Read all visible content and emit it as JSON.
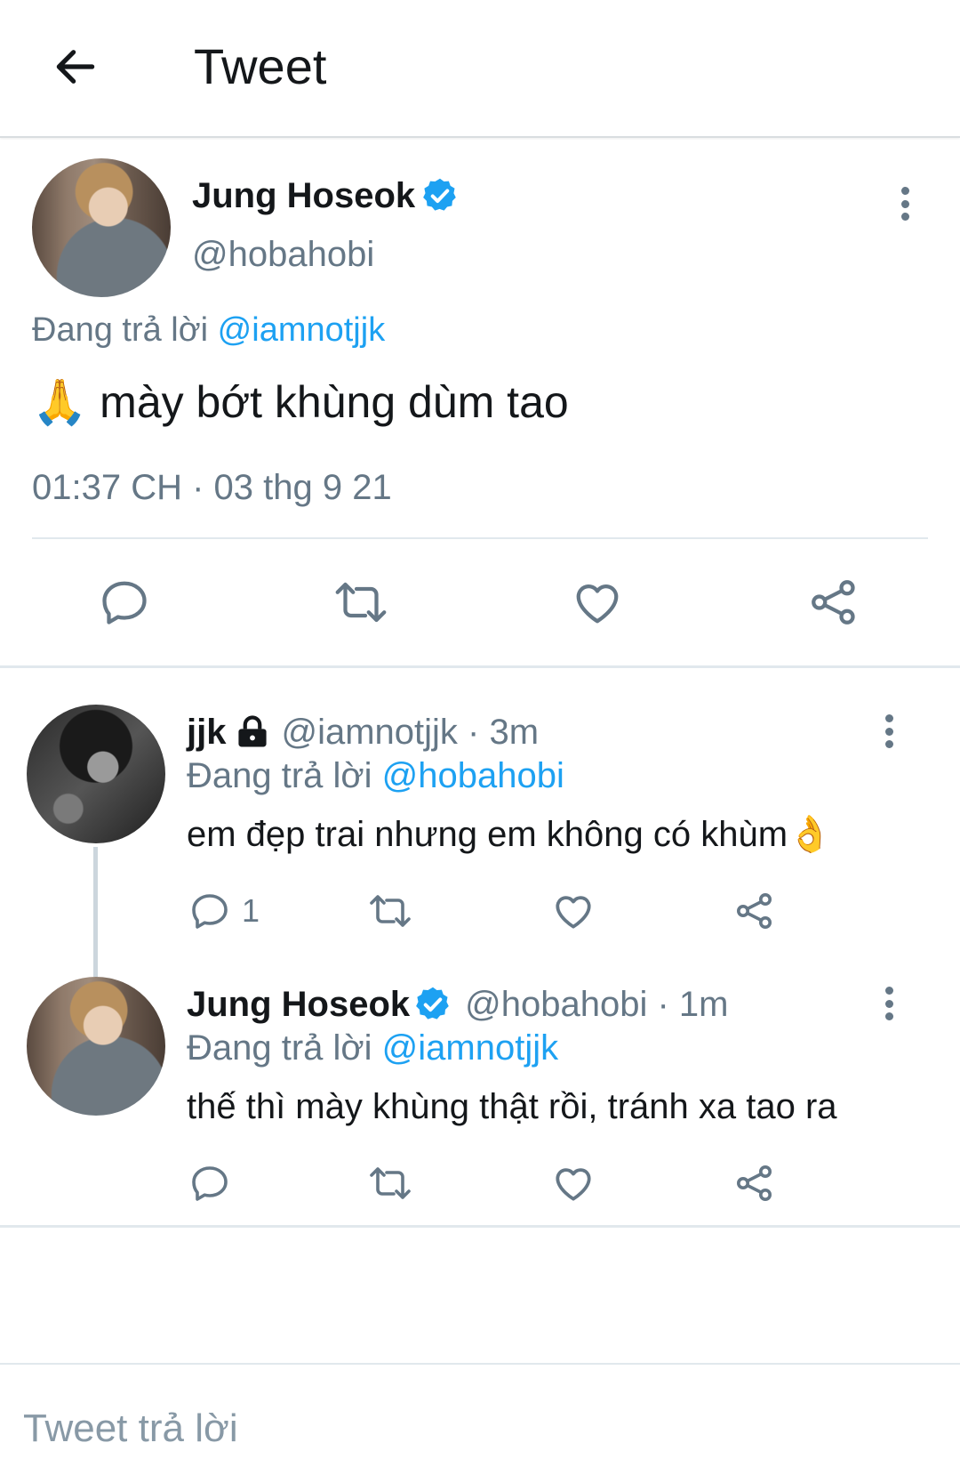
{
  "header": {
    "title": "Tweet"
  },
  "main_tweet": {
    "name": "Jung Hoseok",
    "handle": "@hobahobi",
    "replying_prefix": "Đang trả lời",
    "replying_to": "@iamnotjjk",
    "emoji": "🙏",
    "text": "mày bớt khùng dùm tao",
    "timestamp": "01:37 CH · 03 thg 9 21"
  },
  "replies": [
    {
      "name": "jjk",
      "handle": "@iamnotjjk",
      "time": " · 3m",
      "replying_prefix": "Đang trả lời",
      "replying_to": "@hobahobi",
      "text": "em đẹp trai nhưng em không có khùm",
      "emoji": "👌",
      "reply_count": "1"
    },
    {
      "name": "Jung Hoseok",
      "handle": "@hobahobi",
      "time": " · 1m",
      "replying_prefix": "Đang trả lời",
      "replying_to": "@iamnotjjk",
      "text": "thế thì mày khùng thật rồi, tránh xa tao ra"
    }
  ],
  "compose": {
    "placeholder": "Tweet trả lời"
  },
  "colors": {
    "accent": "#1da1f2",
    "muted": "#657786",
    "divider": "#e1e8ed"
  },
  "icons": [
    "back-arrow-icon",
    "verified-badge-icon",
    "more-options-icon",
    "lock-icon",
    "reply-icon",
    "retweet-icon",
    "like-icon",
    "share-icon"
  ]
}
